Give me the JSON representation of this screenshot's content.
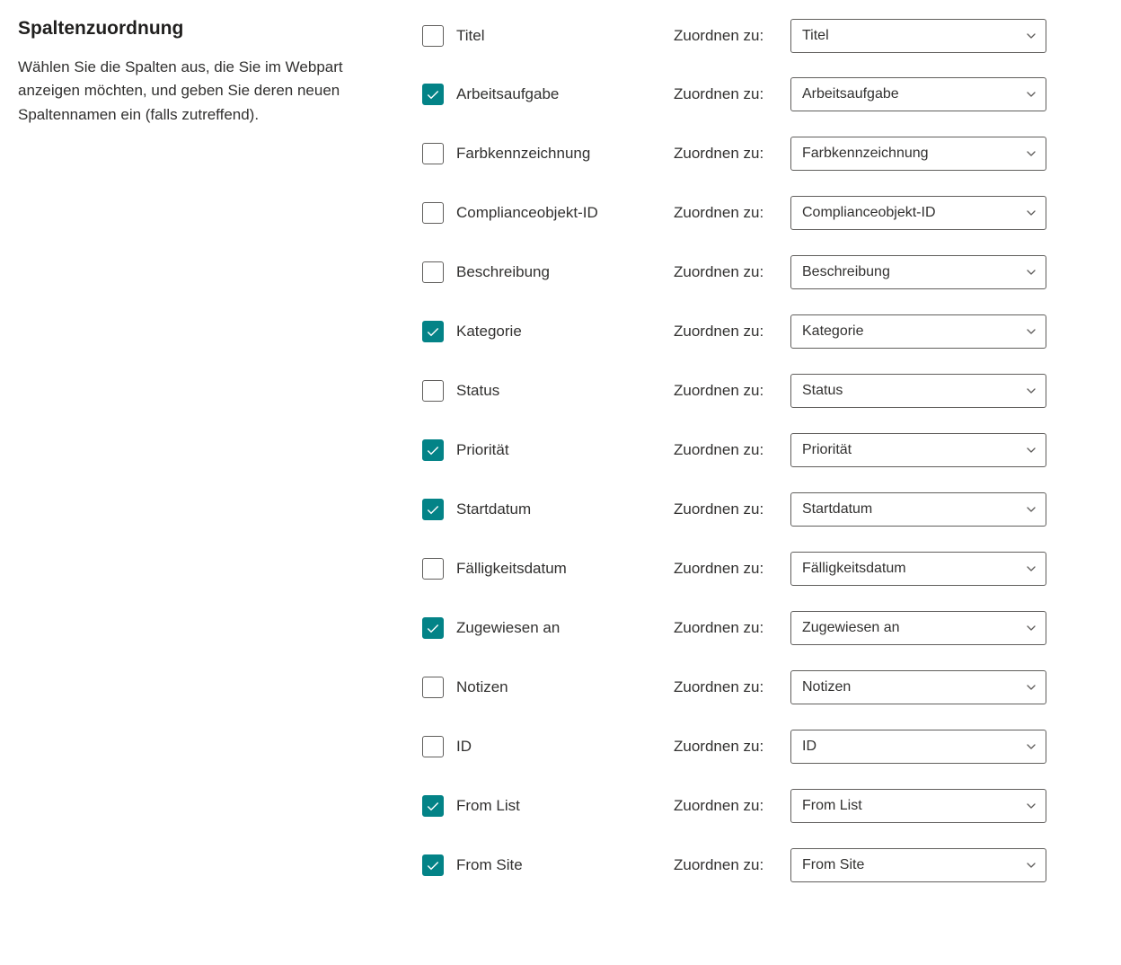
{
  "header": {
    "title": "Spaltenzuordnung",
    "description": "Wählen Sie die Spalten aus, die Sie im Webpart anzeigen möchten, und geben Sie deren neuen Spaltennamen ein (falls zutreffend)."
  },
  "mapLabel": "Zuordnen zu:",
  "rows": [
    {
      "label": "Titel",
      "checked": false,
      "mapValue": "Titel"
    },
    {
      "label": "Arbeitsaufgabe",
      "checked": true,
      "mapValue": "Arbeitsaufgabe"
    },
    {
      "label": "Farbkennzeichnung",
      "checked": false,
      "mapValue": "Farbkennzeichnung"
    },
    {
      "label": "Complianceobjekt-ID",
      "checked": false,
      "mapValue": "Complianceobjekt-ID"
    },
    {
      "label": "Beschreibung",
      "checked": false,
      "mapValue": "Beschreibung"
    },
    {
      "label": "Kategorie",
      "checked": true,
      "mapValue": "Kategorie"
    },
    {
      "label": "Status",
      "checked": false,
      "mapValue": "Status"
    },
    {
      "label": "Priorität",
      "checked": true,
      "mapValue": "Priorität"
    },
    {
      "label": "Startdatum",
      "checked": true,
      "mapValue": "Startdatum"
    },
    {
      "label": "Fälligkeitsdatum",
      "checked": false,
      "mapValue": "Fälligkeitsdatum"
    },
    {
      "label": "Zugewiesen an",
      "checked": true,
      "mapValue": "Zugewiesen an"
    },
    {
      "label": "Notizen",
      "checked": false,
      "mapValue": "Notizen"
    },
    {
      "label": "ID",
      "checked": false,
      "mapValue": "ID"
    },
    {
      "label": "From List",
      "checked": true,
      "mapValue": "From List"
    },
    {
      "label": "From Site",
      "checked": true,
      "mapValue": "From Site"
    }
  ]
}
